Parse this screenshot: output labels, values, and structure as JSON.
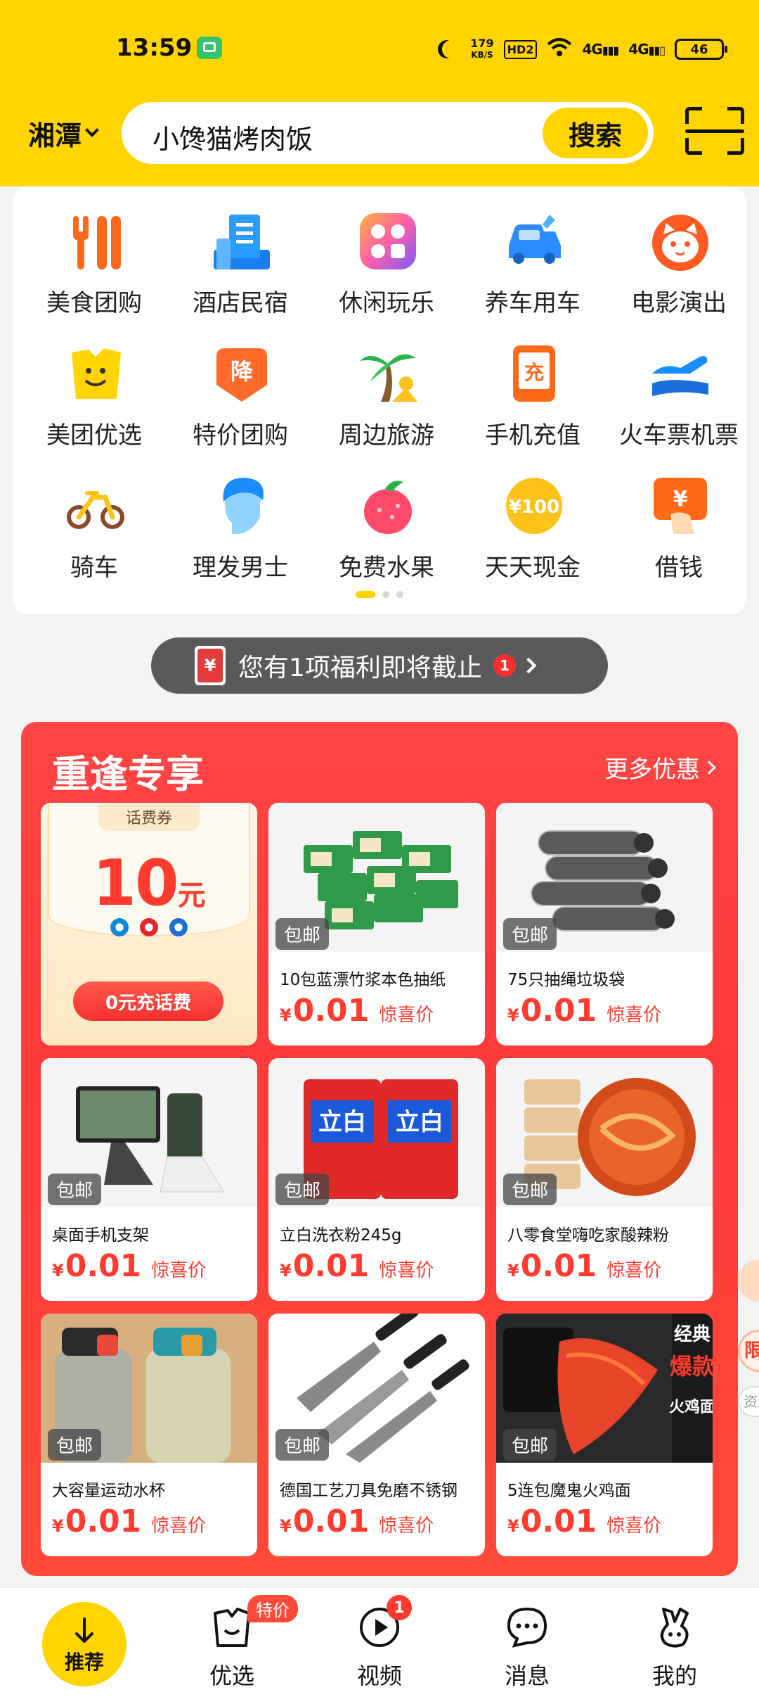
{
  "status_bar": {
    "time": "13:59",
    "net_speed_value": "179",
    "net_speed_unit": "KB/S",
    "hd_label": "HD2",
    "signal_1": "4G",
    "signal_2": "4G",
    "battery": "46"
  },
  "header": {
    "city": "湘潭",
    "search_value": "小馋猫烤肉饭",
    "search_button": "搜索"
  },
  "categories": [
    {
      "label": "美食团购",
      "icon": "fork-knife-icon"
    },
    {
      "label": "酒店民宿",
      "icon": "hotel-building-icon"
    },
    {
      "label": "休闲玩乐",
      "icon": "leisure-grid-icon"
    },
    {
      "label": "养车用车",
      "icon": "car-wrench-icon"
    },
    {
      "label": "电影演出",
      "icon": "cat-face-icon"
    },
    {
      "label": "美团优选",
      "icon": "smile-bag-icon"
    },
    {
      "label": "特价团购",
      "icon": "discount-tag-icon"
    },
    {
      "label": "周边旅游",
      "icon": "palm-tree-icon"
    },
    {
      "label": "手机充值",
      "icon": "phone-recharge-icon"
    },
    {
      "label": "火车票机票",
      "icon": "plane-icon"
    },
    {
      "label": "骑车",
      "icon": "bicycle-icon"
    },
    {
      "label": "理发男士",
      "icon": "barber-head-icon"
    },
    {
      "label": "免费水果",
      "icon": "strawberry-icon"
    },
    {
      "label": "天天现金",
      "icon": "coin-icon"
    },
    {
      "label": "借钱",
      "icon": "loan-card-icon"
    }
  ],
  "notice": {
    "text": "您有1项福利即将截止",
    "count": "1"
  },
  "promo": {
    "title": "重逢专享",
    "more": "更多优惠",
    "coupon": {
      "label": "话费券",
      "amount": "10",
      "unit": "元",
      "button": "0元充话费"
    },
    "tag": "包邮",
    "price_symbol": "¥",
    "price_suffix": "惊喜价",
    "products": [
      {
        "name": "10包蓝漂竹浆本色抽纸",
        "price": "0.01"
      },
      {
        "name": "75只抽绳垃圾袋",
        "price": "0.01"
      },
      {
        "name": "桌面手机支架",
        "price": "0.01"
      },
      {
        "name": "立白洗衣粉245g",
        "price": "0.01"
      },
      {
        "name": "八零食堂嗨吃家酸辣粉",
        "price": "0.01"
      },
      {
        "name": "大容量运动水杯",
        "price": "0.01"
      },
      {
        "name": "德国工艺刀具免磨不锈钢",
        "price": "0.01"
      },
      {
        "name": "5连包魔鬼火鸡面",
        "price": "0.01"
      }
    ],
    "product_image_text": {
      "detergent": "立白",
      "noodle_badge_1": "经典",
      "noodle_badge_2": "爆款",
      "noodle_badge_3": "火鸡面",
      "recharge_char": "充",
      "discount_char": "降",
      "coin": "¥100",
      "loan": "¥"
    }
  },
  "float": {
    "label_1": "限",
    "label_2": "资质"
  },
  "bottom_nav": {
    "home": "推荐",
    "items": [
      {
        "label": "优选",
        "badge": "特价"
      },
      {
        "label": "视频",
        "badge": "1"
      },
      {
        "label": "消息",
        "badge": ""
      },
      {
        "label": "我的",
        "badge": ""
      }
    ]
  },
  "colors": {
    "brand_yellow": "#ffd400",
    "promo_red": "#ff3a3a",
    "price_red": "#ff3b2f"
  }
}
